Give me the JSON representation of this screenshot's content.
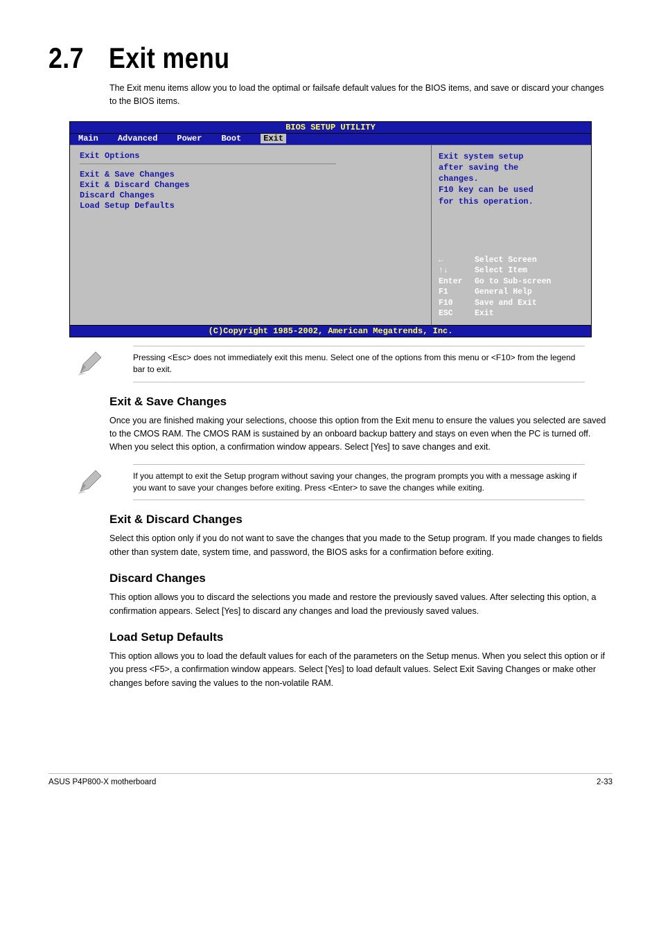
{
  "title": "2.7 Exit menu",
  "intro": "The Exit menu items allow you to load the optimal or failsafe default values for the BIOS items, and save or discard your changes to the BIOS items.",
  "bios": {
    "header": "BIOS SETUP UTILITY",
    "tabs": [
      "Main",
      "Advanced",
      "Power",
      "Boot",
      "Exit"
    ],
    "active_tab_index": 4,
    "left_heading": "Exit Options",
    "items": [
      "Exit & Save Changes",
      "Exit & Discard Changes",
      "Discard Changes",
      "",
      "Load Setup Defaults"
    ],
    "help_lines": [
      "Exit system setup",
      "after saving the",
      "changes.",
      "",
      "F10 key can be used",
      "for this operation."
    ],
    "keys": [
      {
        "k": "←",
        "label": "Select Screen"
      },
      {
        "k": "↑↓",
        "label": "Select Item"
      },
      {
        "k": "Enter",
        "label": "Go to Sub-screen"
      },
      {
        "k": "F1",
        "label": "General Help"
      },
      {
        "k": "F10",
        "label": "Save and Exit"
      },
      {
        "k": "ESC",
        "label": "Exit"
      }
    ],
    "footer": "(C)Copyright 1985-2002, American Megatrends, Inc."
  },
  "note1": "Pressing <Esc> does not immediately exit this menu. Select one of the options from this menu or <F10> from the legend bar to exit.",
  "sub1": {
    "title": "Exit & Save Changes",
    "body": "Once you are finished making your selections, choose this option from the Exit menu to ensure the values you selected are saved to the CMOS RAM. The CMOS RAM is sustained by an onboard backup battery and stays on even when the PC is turned off. When you select this option, a confirmation window appears. Select [Yes] to save changes and exit."
  },
  "note2": "If you attempt to exit the Setup program without saving your changes, the program prompts you with a message asking if you want to save your changes before exiting. Press <Enter> to save the changes while exiting.",
  "sub2": {
    "title": "Exit & Discard Changes",
    "body": "Select this option only if you do not want to save the changes that you made to the Setup program. If you made changes to fields other than system date, system time, and password, the BIOS asks for a confirmation before exiting."
  },
  "sub3": {
    "title": "Discard Changes",
    "body": "This option allows you to discard the selections you made and restore the previously saved values. After selecting this option, a confirmation appears. Select [Yes] to discard any changes and load the previously saved values."
  },
  "sub4": {
    "title": "Load Setup Defaults",
    "body": "This option allows you to load the default values for each of the parameters on the Setup menus. When you select this option or if you press <F5>, a confirmation window appears. Select [Yes] to load default values. Select Exit Saving Changes or make other changes before saving the values to the non-volatile RAM."
  },
  "footer": {
    "left": "ASUS P4P800-X motherboard",
    "right": "2-33"
  }
}
